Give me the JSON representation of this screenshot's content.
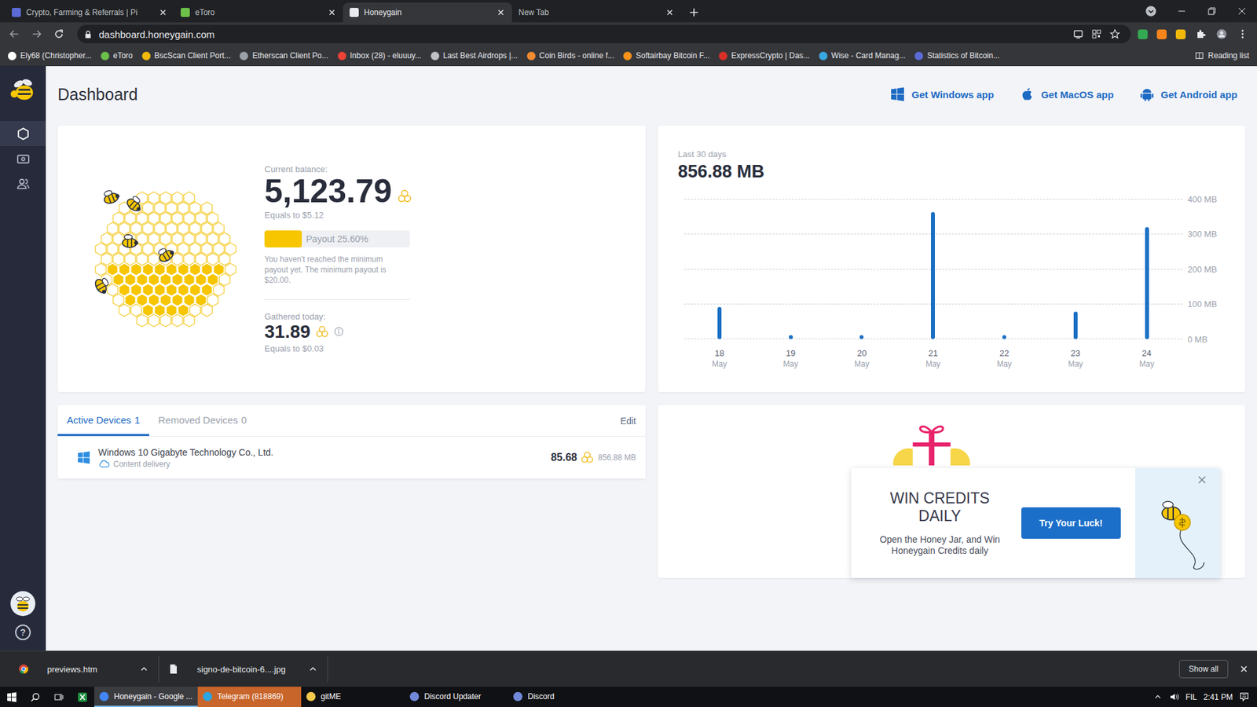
{
  "browser": {
    "tabs": [
      {
        "label": "Crypto, Farming & Referrals | Pi",
        "selected": false,
        "favicon": "#5b6bd6"
      },
      {
        "label": "eToro",
        "selected": false,
        "favicon": "#6cc04a"
      },
      {
        "label": "Honeygain",
        "selected": true,
        "favicon": "#e8eaed"
      },
      {
        "label": "New Tab",
        "selected": false,
        "favicon": ""
      }
    ],
    "address": "dashboard.honeygain.com",
    "bookmarks": [
      {
        "label": "Ely68 (Christopher...",
        "color": "#ffffff"
      },
      {
        "label": "eToro",
        "color": "#6cc04a"
      },
      {
        "label": "BscScan Client Port...",
        "color": "#f0b90b"
      },
      {
        "label": "Etherscan Client Po...",
        "color": "#9aa0a6"
      },
      {
        "label": "Inbox (28) - eluuuy...",
        "color": "#ea4335"
      },
      {
        "label": "Last Best Airdrops |...",
        "color": "#bdc1c6"
      },
      {
        "label": "Coin Birds - online f...",
        "color": "#f28b30"
      },
      {
        "label": "Softairbay Bitcoin F...",
        "color": "#f7931a"
      },
      {
        "label": "ExpressCrypto | Das...",
        "color": "#d93025"
      },
      {
        "label": "Wise - Card Manag...",
        "color": "#3aa8e0"
      },
      {
        "label": "Statistics of Bitcoin...",
        "color": "#5b6bd6"
      }
    ],
    "reading_list": "Reading list"
  },
  "sidebar": {
    "items": [
      {
        "kind": "dashboard",
        "selected": true
      },
      {
        "kind": "wallet",
        "selected": false
      },
      {
        "kind": "referrals",
        "selected": false
      }
    ],
    "help": "?"
  },
  "page": {
    "title": "Dashboard",
    "app_links": [
      {
        "kind": "windows",
        "label": "Get Windows app"
      },
      {
        "kind": "apple",
        "label": "Get MacOS app"
      },
      {
        "kind": "android",
        "label": "Get Android app"
      }
    ]
  },
  "balance": {
    "label": "Current balance:",
    "value": "5,123.79",
    "equals": "Equals to $5.12",
    "payout": {
      "label": "Payout 25.60%",
      "level": 0.256,
      "note": "You haven't reached the minimum payout yet. The minimum payout is $20.00."
    },
    "today_label": "Gathered today:",
    "today_value": "31.89",
    "today_equals": "Equals to $0.03"
  },
  "chart": {
    "period": "Last 30 days",
    "total": "856.88 MB",
    "y_ticks": [
      "400 MB",
      "300 MB",
      "200 MB",
      "100 MB",
      "0 MB"
    ],
    "days": [
      {
        "day": "18",
        "month": "May"
      },
      {
        "day": "19",
        "month": "May"
      },
      {
        "day": "20",
        "month": "May"
      },
      {
        "day": "21",
        "month": "May"
      },
      {
        "day": "22",
        "month": "May"
      },
      {
        "day": "23",
        "month": "May"
      },
      {
        "day": "24",
        "month": "May"
      }
    ],
    "values": [
      92,
      0.5,
      3,
      362,
      1,
      78,
      320
    ]
  },
  "devices": {
    "tabs": [
      {
        "label": "Active Devices",
        "count": "1",
        "selected": true
      },
      {
        "label": "Removed Devices",
        "count": "0",
        "selected": false
      }
    ],
    "edit": "Edit",
    "rows": [
      {
        "name": "Windows 10 Gigabyte Technology Co., Ltd.",
        "type": "Content delivery",
        "credits": "85.68",
        "traffic": "856.88 MB"
      }
    ]
  },
  "promo": {
    "title": "WIN CREDITS DAILY",
    "text": "Open the Honey Jar, and Win Honeygain Credits daily",
    "button": "Try Your Luck!"
  },
  "downloads": {
    "items": [
      {
        "name": "previews.htm",
        "kind": "chrome"
      },
      {
        "name": "signo-de-bitcoin-6....jpg",
        "kind": "file"
      }
    ],
    "show_all": "Show all"
  },
  "taskbar": {
    "items": [
      {
        "label": "Honeygain - Google ...",
        "selected": true,
        "attention": false,
        "color": "#4285f4"
      },
      {
        "label": "Telegram (818869)",
        "selected": false,
        "attention": true,
        "color": "#2ca5e0"
      },
      {
        "label": "gitME",
        "selected": false,
        "attention": false,
        "color": "#f2c94c"
      },
      {
        "label": "Discord Updater",
        "selected": false,
        "attention": false,
        "color": "#7289da"
      },
      {
        "label": "Discord",
        "selected": false,
        "attention": false,
        "color": "#7289da"
      }
    ],
    "lang": "FIL",
    "time": "2:41 PM"
  }
}
